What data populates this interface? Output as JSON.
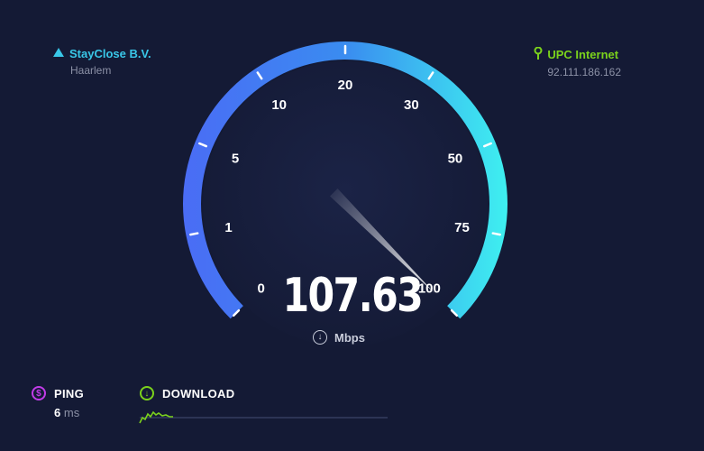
{
  "server": {
    "name": "StayClose B.V.",
    "location": "Haarlem",
    "icon": "server-icon"
  },
  "isp": {
    "name": "UPC Internet",
    "ip": "92.111.186.162",
    "icon": "isp-icon"
  },
  "gauge": {
    "scale_labels": [
      "0",
      "1",
      "5",
      "10",
      "20",
      "30",
      "50",
      "75",
      "100"
    ],
    "speed_value": "107.63",
    "units": "Mbps",
    "needle_fraction": 1.0,
    "gradient_start": "#4a6cf5",
    "gradient_end": "#3ef0f0"
  },
  "stats": {
    "ping_label": "PING",
    "ping_value": "6",
    "ping_unit": "ms",
    "download_label": "DOWNLOAD",
    "ping_color": "#c23ce8",
    "download_color": "#7bd21c"
  }
}
